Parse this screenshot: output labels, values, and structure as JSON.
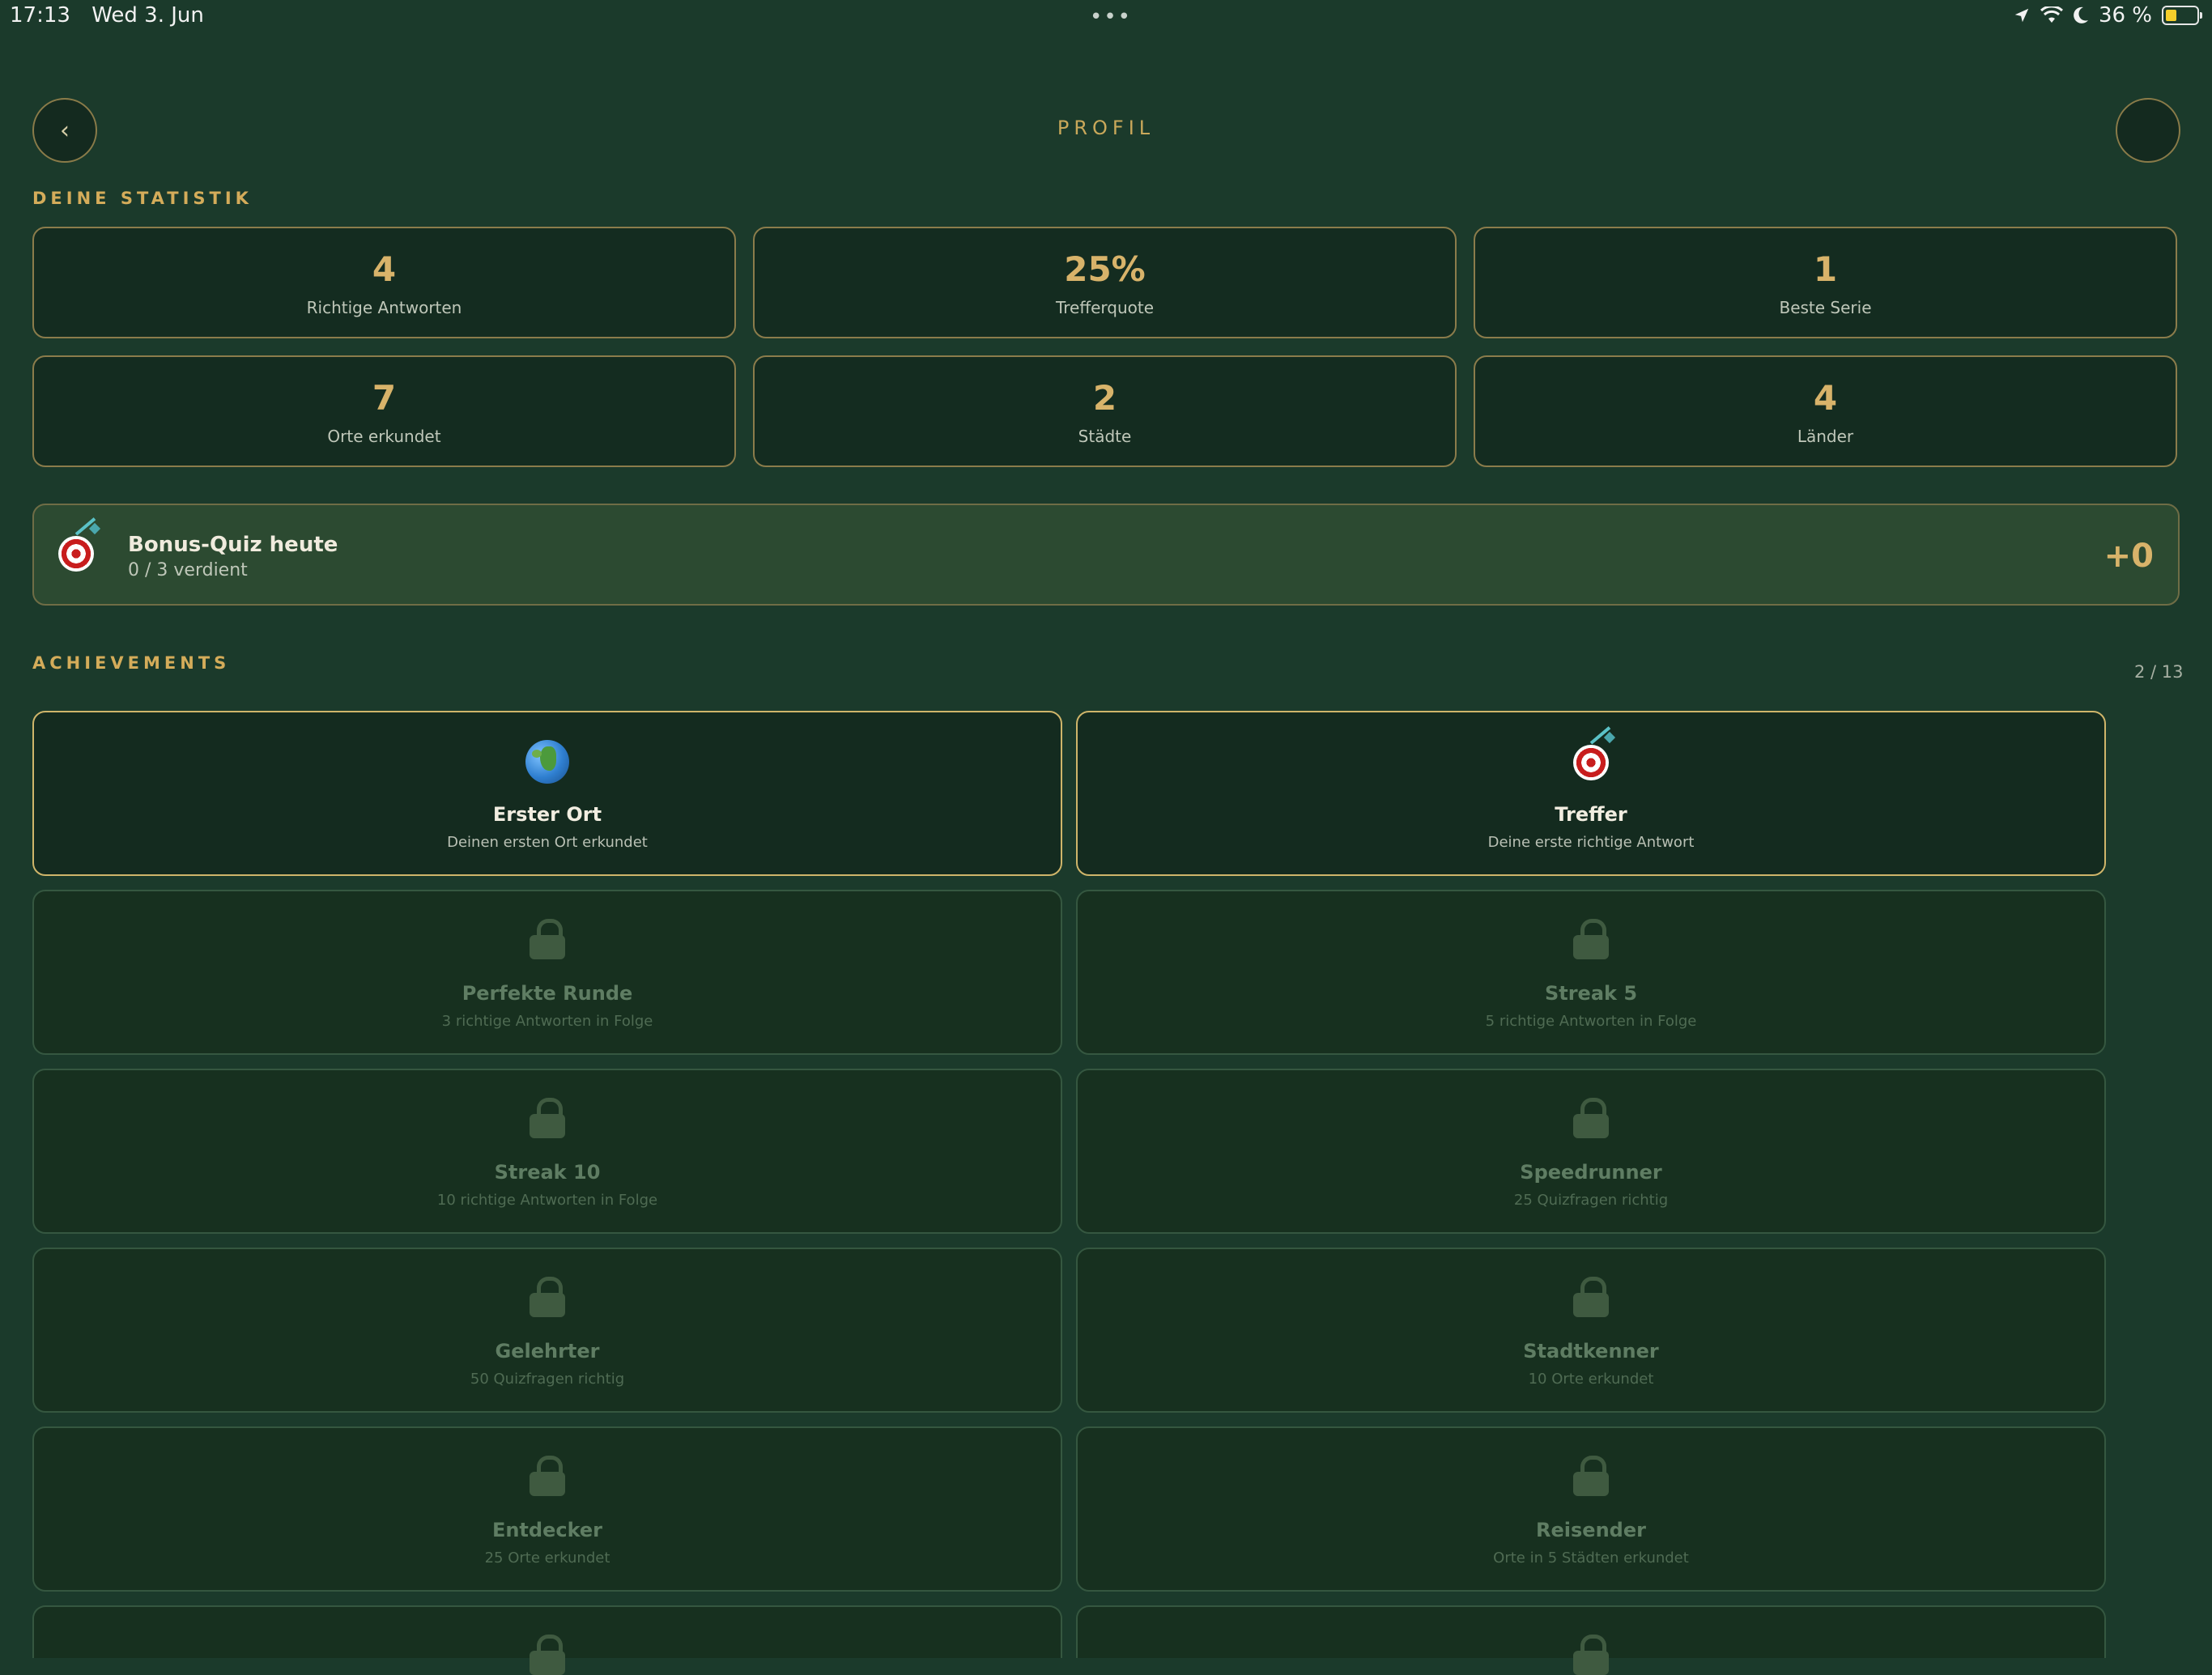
{
  "status_bar": {
    "time": "17:13",
    "date": "Wed 3. Jun",
    "battery_text": "36 %",
    "battery_level_percent": 36
  },
  "header": {
    "title": "PROFIL",
    "back_glyph": "‹"
  },
  "stats_section": {
    "label": "DEINE STATISTIK"
  },
  "stats": [
    {
      "value": "4",
      "label": "Richtige Antworten"
    },
    {
      "value": "25%",
      "label": "Trefferquote"
    },
    {
      "value": "1",
      "label": "Beste Serie"
    },
    {
      "value": "7",
      "label": "Orte erkundet"
    },
    {
      "value": "2",
      "label": "Städte"
    },
    {
      "value": "4",
      "label": "Länder"
    }
  ],
  "bonus": {
    "icon": "target-icon",
    "title": "Bonus-Quiz heute",
    "subtitle": "0 / 3 verdient",
    "value": "+0"
  },
  "achievements_section": {
    "label": "ACHIEVEMENTS",
    "count": "2 / 13"
  },
  "achievements": [
    {
      "title": "Erster Ort",
      "description": "Deinen ersten Ort erkundet",
      "unlocked": true,
      "icon": "globe-icon"
    },
    {
      "title": "Treffer",
      "description": "Deine erste richtige Antwort",
      "unlocked": true,
      "icon": "target-icon"
    },
    {
      "title": "Perfekte Runde",
      "description": "3 richtige Antworten in Folge",
      "unlocked": false,
      "icon": "lock-icon"
    },
    {
      "title": "Streak 5",
      "description": "5 richtige Antworten in Folge",
      "unlocked": false,
      "icon": "lock-icon"
    },
    {
      "title": "Streak 10",
      "description": "10 richtige Antworten in Folge",
      "unlocked": false,
      "icon": "lock-icon"
    },
    {
      "title": "Speedrunner",
      "description": "25 Quizfragen richtig",
      "unlocked": false,
      "icon": "lock-icon"
    },
    {
      "title": "Gelehrter",
      "description": "50 Quizfragen richtig",
      "unlocked": false,
      "icon": "lock-icon"
    },
    {
      "title": "Stadtkenner",
      "description": "10 Orte erkundet",
      "unlocked": false,
      "icon": "lock-icon"
    },
    {
      "title": "Entdecker",
      "description": "25 Orte erkundet",
      "unlocked": false,
      "icon": "lock-icon"
    },
    {
      "title": "Reisender",
      "description": "Orte in 5 Städten erkundet",
      "unlocked": false,
      "icon": "lock-icon"
    },
    {
      "title": "",
      "description": "",
      "unlocked": false,
      "icon": "lock-icon"
    },
    {
      "title": "",
      "description": "",
      "unlocked": false,
      "icon": "lock-icon"
    }
  ],
  "colors": {
    "background": "#1b3a2b",
    "accent_gold": "#d8b36a",
    "card_bg": "#142c20",
    "locked_text": "#5f7d63"
  }
}
